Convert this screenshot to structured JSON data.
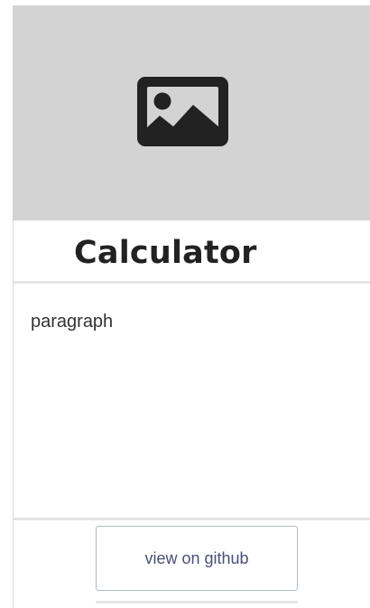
{
  "card": {
    "image": {
      "icon": "image-icon",
      "background_color": "#d3d3d3",
      "icon_color": "#222222"
    },
    "title": "Calculator",
    "text": "paragraph",
    "button_label": "view on github"
  }
}
